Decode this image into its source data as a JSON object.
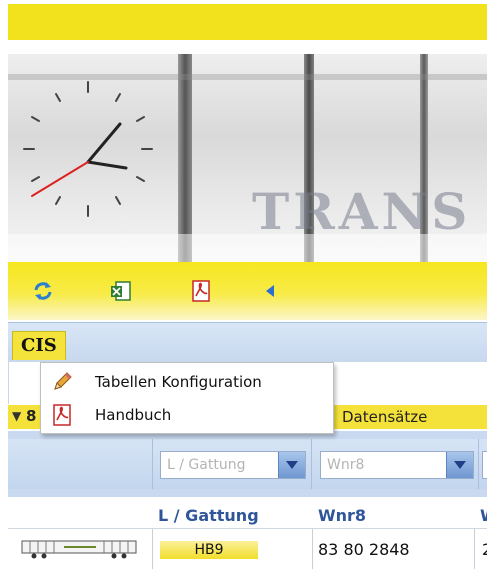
{
  "toolbar": {
    "buttons": [
      {
        "name": "refresh",
        "icon": "refresh-icon"
      },
      {
        "name": "excel-export",
        "icon": "excel-icon"
      },
      {
        "name": "pdf-export",
        "icon": "pdf-icon"
      },
      {
        "name": "back",
        "icon": "arrow-left-icon"
      }
    ]
  },
  "tabs": [
    {
      "label": "CIS"
    }
  ],
  "context_menu": {
    "items": [
      {
        "label": "Tabellen Konfiguration",
        "icon": "pencil-icon"
      },
      {
        "label": "Handbuch",
        "icon": "pdf-icon"
      }
    ]
  },
  "group": {
    "count": "8",
    "label": "Datensätze"
  },
  "filters": [
    {
      "placeholder": "L / Gattung"
    },
    {
      "placeholder": "Wnr8"
    }
  ],
  "table": {
    "columns": [
      "L / Gattung",
      "Wnr8",
      "W"
    ],
    "rows": [
      {
        "gattung": "HB9",
        "wnr8": "83 80 2848",
        "truncated": "2"
      }
    ]
  },
  "colors": {
    "accent_yellow": "#f2e21d",
    "header_blue": "#2f5699",
    "grid_blue": "#c9daf0"
  }
}
